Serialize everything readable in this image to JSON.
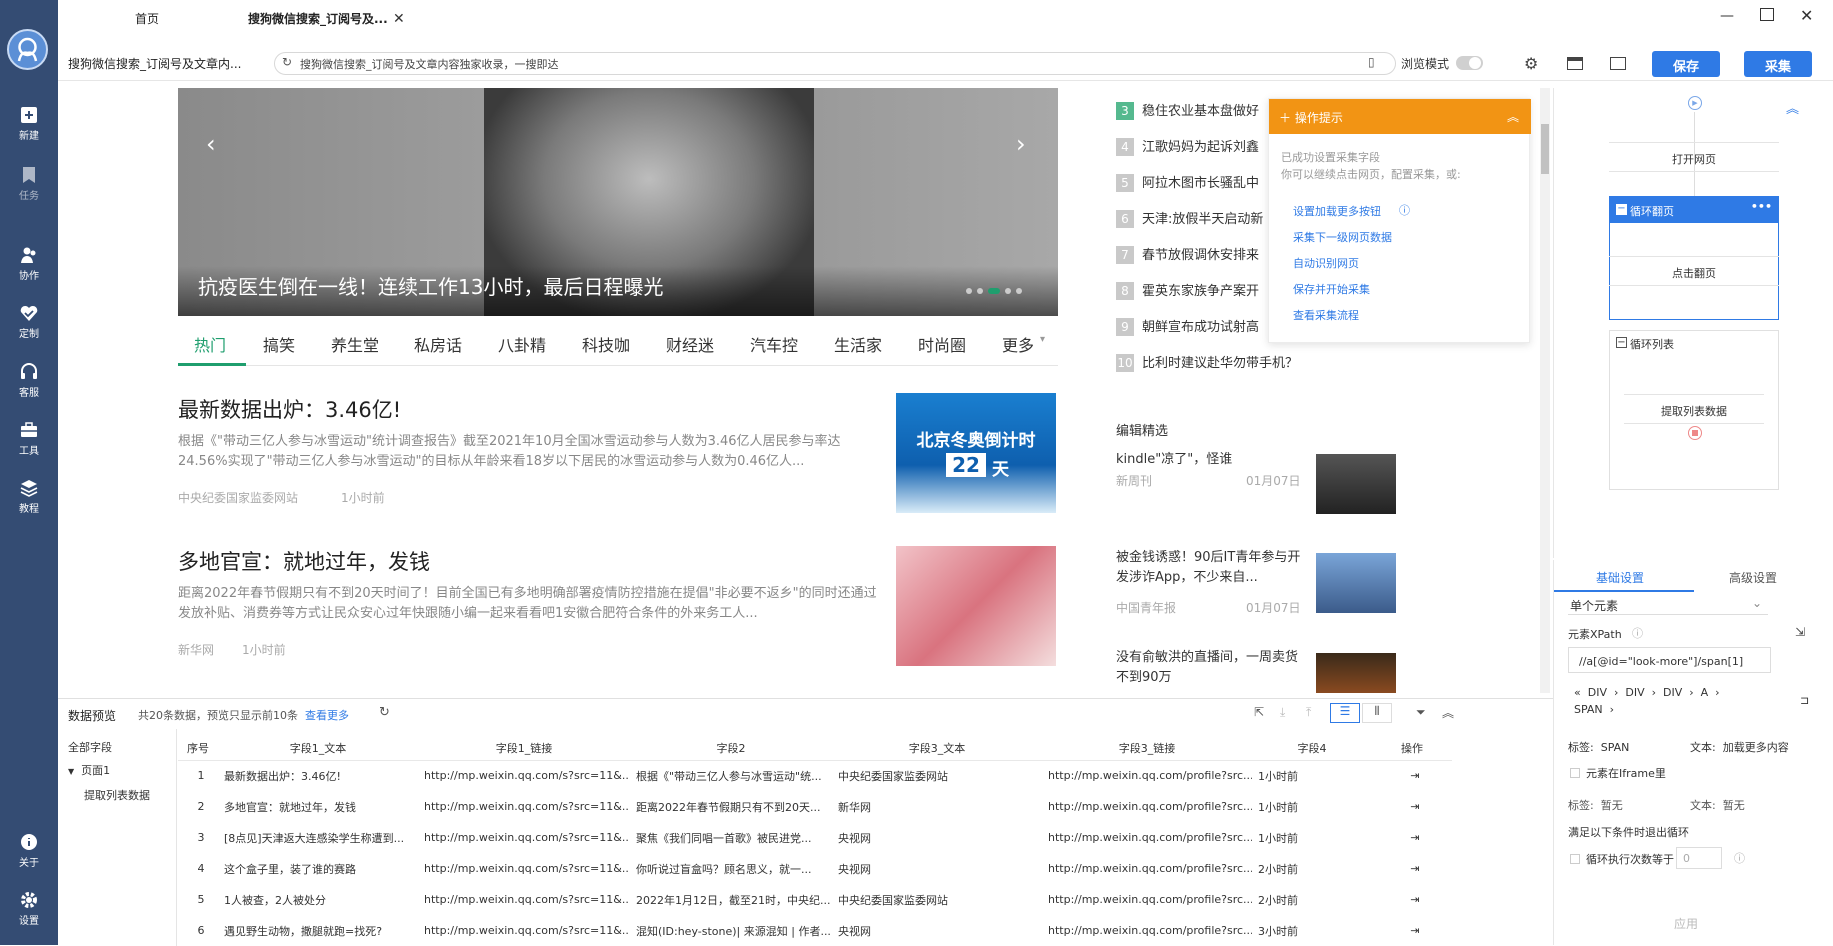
{
  "sidebar": {
    "items": [
      {
        "label": "新建",
        "icon": "plus-square-icon"
      },
      {
        "label": "任务",
        "icon": "bookmark-icon"
      },
      {
        "label": "协作",
        "icon": "users-icon"
      },
      {
        "label": "定制",
        "icon": "heart-check-icon"
      },
      {
        "label": "客服",
        "icon": "headset-icon"
      },
      {
        "label": "工具",
        "icon": "toolbox-icon"
      },
      {
        "label": "教程",
        "icon": "layers-icon"
      }
    ],
    "bottom": [
      {
        "label": "关于",
        "icon": "info-icon"
      },
      {
        "label": "设置",
        "icon": "gear-icon"
      }
    ]
  },
  "tabs": [
    {
      "label": "首页"
    },
    {
      "label": "搜狗微信搜索_订阅号及..."
    }
  ],
  "addressbar": {
    "page_title": "搜狗微信搜索_订阅号及文章内...",
    "url": "搜狗微信搜索_订阅号及文章内容独家收录，一搜即达",
    "browse_mode": "浏览模式",
    "save_label": "保存",
    "collect_label": "采集"
  },
  "hero": {
    "caption": "抗疫医生倒在一线！连续工作13小时，最后日程曝光"
  },
  "nav_tabs": [
    "热门",
    "搞笑",
    "养生堂",
    "私房话",
    "八卦精",
    "科技咖",
    "财经迷",
    "汽车控",
    "生活家",
    "时尚圈",
    "更多"
  ],
  "articles": [
    {
      "title": "最新数据出炉：3.46亿!",
      "desc": "根据《\"带动三亿人参与冰雪运动\"统计调查报告》截至2021年10月全国冰雪运动参与人数为3.46亿人居民参与率达24.56%实现了\"带动三亿人参与冰雪运动\"的目标从年龄来看18岁以下居民的冰雪运动参与人数为0.46亿人...",
      "source": "中央纪委国家监委网站",
      "time": "1小时前",
      "thumb_line1": "北京冬奥倒计时",
      "thumb_days": "22",
      "thumb_unit": "天"
    },
    {
      "title": "多地官宣：就地过年，发钱",
      "desc": "距离2022年春节假期只有不到20天时间了！目前全国已有多地明确部署疫情防控措施在提倡\"非必要不返乡\"的同时还通过发放补贴、消费券等方式让民众安心过年快跟随小编一起来看看吧1安徽合肥符合条件的外来务工人...",
      "source": "新华网",
      "time": "1小时前"
    }
  ],
  "ranking": [
    {
      "num": "3",
      "title": "稳住农业基本盘做好"
    },
    {
      "num": "4",
      "title": "江歌妈妈为起诉刘鑫"
    },
    {
      "num": "5",
      "title": "阿拉木图市长骚乱中"
    },
    {
      "num": "6",
      "title": "天津:放假半天启动新"
    },
    {
      "num": "7",
      "title": "春节放假调休安排来"
    },
    {
      "num": "8",
      "title": "霍英东家族争产案开"
    },
    {
      "num": "9",
      "title": "朝鲜宣布成功试射高"
    },
    {
      "num": "10",
      "title": "比利时建议赴华勿带手机？"
    }
  ],
  "editor_picks": {
    "heading": "编辑精选",
    "items": [
      {
        "title": "kindle\"凉了\"，怪谁",
        "source": "新周刊",
        "date": "01月07日"
      },
      {
        "title": "被金钱诱惑！90后IT青年参与开发涉诈App，不少来自...",
        "source": "中国青年报",
        "date": "01月07日"
      },
      {
        "title": "没有俞敏洪的直播间，一周卖货不到90万",
        "source": "",
        "date": ""
      }
    ]
  },
  "tip_panel": {
    "title": "操作提示",
    "intro1": "已成功设置采集字段",
    "intro2": "你可以继续点击网页，配置采集，或:",
    "links": [
      "设置加载更多按钮",
      "采集下一级网页数据",
      "自动识别网页",
      "保存并开始采集",
      "查看采集流程"
    ]
  },
  "flow": {
    "open_page": "打开网页",
    "loop_page": "循环翻页",
    "click_page": "点击翻页",
    "loop_list": "循环列表",
    "extract": "提取列表数据"
  },
  "settings": {
    "tab_basic": "基础设置",
    "tab_advanced": "高级设置",
    "mode": "单个元素",
    "xpath_label": "元素XPath",
    "xpath_value": "//a[@id=\"look-more\"]/span[1]",
    "path": [
      "DIV",
      "DIV",
      "DIV",
      "A",
      "SPAN"
    ],
    "tag_label": "标签:",
    "tag_value": "SPAN",
    "text_label": "文本:",
    "text_value": "加载更多内容",
    "iframe_label": "元素在Iframe里",
    "tag2_value": "暂无",
    "text2_value": "暂无",
    "exit_label": "满足以下条件时退出循环",
    "loop_count_label": "循环执行次数等于",
    "loop_count_value": "0",
    "apply_label": "应用"
  },
  "preview": {
    "title": "数据预览",
    "summary": "共20条数据，预览只显示前10条",
    "view_more": "查看更多",
    "tree_all": "全部字段",
    "tree_page": "页面1",
    "tree_leaf": "提取列表数据",
    "columns": [
      "序号",
      "字段1_文本",
      "字段1_链接",
      "字段2",
      "字段3_文本",
      "字段3_链接",
      "字段4",
      "操作"
    ],
    "rows": [
      [
        "1",
        "最新数据出炉：3.46亿!",
        "http://mp.weixin.qq.com/s?src=11&...",
        "根据《\"带动三亿人参与冰雪运动\"统...",
        "中央纪委国家监委网站",
        "http://mp.weixin.qq.com/profile?src...",
        "1小时前"
      ],
      [
        "2",
        "多地官宣：就地过年，发钱",
        "http://mp.weixin.qq.com/s?src=11&...",
        "距离2022年春节假期只有不到20天...",
        "新华网",
        "http://mp.weixin.qq.com/profile?src...",
        "1小时前"
      ],
      [
        "3",
        "[8点见]天津返大连感染学生称遭到...",
        "http://mp.weixin.qq.com/s?src=11&...",
        "聚焦《我们同唱一首歌》被民进党...",
        "央视网",
        "http://mp.weixin.qq.com/profile?src...",
        "1小时前"
      ],
      [
        "4",
        "这个盒子里，装了谁的赛路",
        "http://mp.weixin.qq.com/s?src=11&...",
        "你听说过盲盒吗？顾名思义，就一...",
        "央视网",
        "http://mp.weixin.qq.com/profile?src...",
        "2小时前"
      ],
      [
        "5",
        "1人被查，2人被处分",
        "http://mp.weixin.qq.com/s?src=11&...",
        "2022年1月12日，截至21时，中央纪...",
        "中央纪委国家监委网站",
        "http://mp.weixin.qq.com/profile?src...",
        "2小时前"
      ],
      [
        "6",
        "遇见野生动物，撒腿就跑=找死?",
        "http://mp.weixin.qq.com/s?src=11&...",
        "混知(ID:hey-stone)| 来源混知 | 作者...",
        "央视网",
        "http://mp.weixin.qq.com/profile?src...",
        "3小时前"
      ]
    ]
  },
  "colors": {
    "sidebar": "#344c73",
    "accent": "#2f7ae5",
    "tip": "#f29414",
    "active_tab": "#1f9e6e"
  }
}
